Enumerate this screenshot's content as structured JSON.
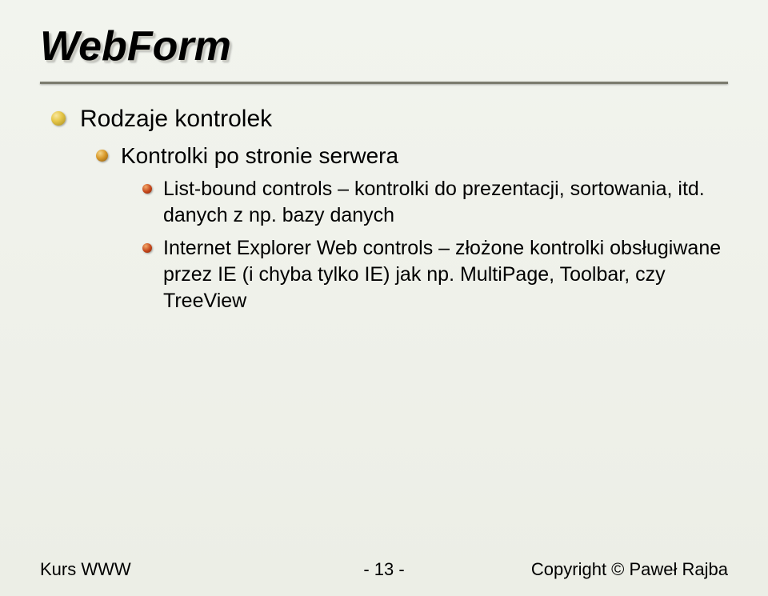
{
  "title": "WebForm",
  "level1": {
    "text": "Rodzaje kontrolek"
  },
  "level2": {
    "text": "Kontrolki po stronie serwera"
  },
  "level3a": {
    "text": "List-bound controls – kontrolki do prezentacji, sortowania, itd. danych z np. bazy danych"
  },
  "level3b": {
    "text": "Internet Explorer Web controls – złożone kontrolki obsługiwane przez IE (i chyba tylko IE) jak np. MultiPage, Toolbar, czy TreeView"
  },
  "footer": {
    "left": "Kurs WWW",
    "page": "- 13 -",
    "right": "Copyright © Paweł Rajba"
  }
}
